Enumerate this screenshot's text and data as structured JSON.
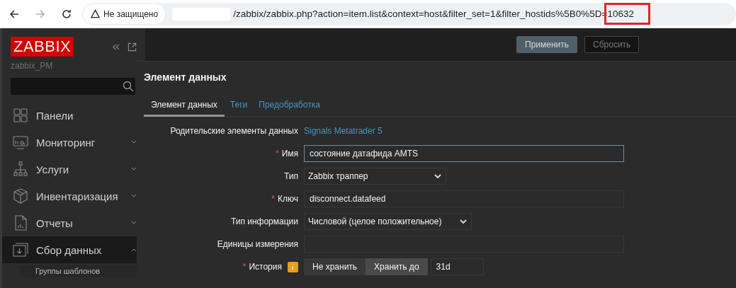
{
  "browser": {
    "security_label": "Не защищено",
    "url_path": "/zabbix/zabbix.php?action=item.list&context=host&filter_set=1&filter_hostids%5B0%5D=",
    "url_highlight": "10632"
  },
  "sidebar": {
    "logo": "ZABBIX",
    "server_name": "zabbix_PM",
    "items": [
      {
        "label": "Панели",
        "expandable": false,
        "selected": false
      },
      {
        "label": "Мониторинг",
        "expandable": true,
        "expanded": false,
        "selected": false
      },
      {
        "label": "Услуги",
        "expandable": true,
        "expanded": false,
        "selected": false
      },
      {
        "label": "Инвентаризация",
        "expandable": true,
        "expanded": false,
        "selected": false
      },
      {
        "label": "Отчеты",
        "expandable": true,
        "expanded": false,
        "selected": false
      },
      {
        "label": "Сбор данных",
        "expandable": true,
        "expanded": true,
        "selected": true,
        "children": [
          {
            "label": "Группы шаблонов"
          }
        ]
      }
    ]
  },
  "filter": {
    "buttons": [
      {
        "label": "Применить",
        "primary": true
      },
      {
        "label": "Сбросить",
        "primary": false
      }
    ]
  },
  "dialog": {
    "title": "Элемент данных",
    "tabs": [
      {
        "label": "Элемент данных",
        "selected": true
      },
      {
        "label": "Теги",
        "selected": false
      },
      {
        "label": "Предобработка",
        "selected": false
      }
    ],
    "fields": [
      {
        "kind": "link",
        "label": "Родительские элементы данных",
        "value": "Signals Metatrader 5"
      },
      {
        "kind": "text",
        "label": "Имя",
        "required_mark": "*",
        "focused": true,
        "value": "состояние датафида AMTS"
      },
      {
        "kind": "select",
        "label": "Тип",
        "value": "Zabbix траппер"
      },
      {
        "kind": "text",
        "label": "Ключ",
        "required_mark": "*",
        "focused": false,
        "value": "disconnect.datafeed"
      },
      {
        "kind": "select",
        "label": "Тип информации",
        "value": "Числовой (целое положительное)"
      },
      {
        "kind": "text",
        "label": "Единицы измерения",
        "focused": false
      },
      {
        "kind": "history",
        "label": "История",
        "required_mark": "*",
        "info": true,
        "options": [
          {
            "label": "Не хранить",
            "selected": false
          },
          {
            "label": "Хранить до",
            "selected": true
          }
        ],
        "value": "31d"
      }
    ]
  }
}
